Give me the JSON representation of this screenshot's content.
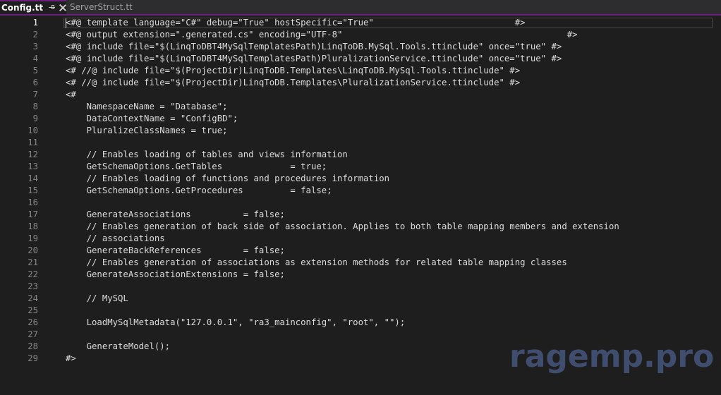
{
  "tabs": [
    {
      "label": "Config.tt"
    },
    {
      "label": "ServerStruct.tt"
    }
  ],
  "editor": {
    "lines": [
      {
        "n": "1",
        "text": "<#@ template language=\"C#\" debug=\"True\" hostSpecific=\"True\"                           #>"
      },
      {
        "n": "2",
        "text": "<#@ output extension=\".generated.cs\" encoding=\"UTF-8\"                                           #>"
      },
      {
        "n": "3",
        "text": "<#@ include file=\"$(LinqToDBT4MySqlTemplatesPath)LinqToDB.MySql.Tools.ttinclude\" once=\"true\" #>"
      },
      {
        "n": "4",
        "text": "<#@ include file=\"$(LinqToDBT4MySqlTemplatesPath)PluralizationService.ttinclude\" once=\"true\" #>"
      },
      {
        "n": "5",
        "text": "<# //@ include file=\"$(ProjectDir)LinqToDB.Templates\\LinqToDB.MySql.Tools.ttinclude\" #>"
      },
      {
        "n": "6",
        "text": "<# //@ include file=\"$(ProjectDir)LinqToDB.Templates\\PluralizationService.ttinclude\" #>"
      },
      {
        "n": "7",
        "text": "<#"
      },
      {
        "n": "8",
        "text": "    NamespaceName = \"Database\";"
      },
      {
        "n": "9",
        "text": "    DataContextName = \"ConfigBD\";"
      },
      {
        "n": "10",
        "text": "    PluralizeClassNames = true;"
      },
      {
        "n": "11",
        "text": ""
      },
      {
        "n": "12",
        "text": "    // Enables loading of tables and views information"
      },
      {
        "n": "13",
        "text": "    GetSchemaOptions.GetTables             = true;"
      },
      {
        "n": "14",
        "text": "    // Enables loading of functions and procedures information"
      },
      {
        "n": "15",
        "text": "    GetSchemaOptions.GetProcedures         = false;"
      },
      {
        "n": "16",
        "text": ""
      },
      {
        "n": "17",
        "text": "    GenerateAssociations          = false;"
      },
      {
        "n": "18",
        "text": "    // Enables generation of back side of association. Applies to both table mapping members and extension"
      },
      {
        "n": "19",
        "text": "    // associations"
      },
      {
        "n": "20",
        "text": "    GenerateBackReferences        = false;"
      },
      {
        "n": "21",
        "text": "    // Enables generation of associations as extension methods for related table mapping classes"
      },
      {
        "n": "22",
        "text": "    GenerateAssociationExtensions = false;"
      },
      {
        "n": "23",
        "text": ""
      },
      {
        "n": "24",
        "text": "    // MySQL"
      },
      {
        "n": "25",
        "text": ""
      },
      {
        "n": "26",
        "text": "    LoadMySqlMetadata(\"127.0.0.1\", \"ra3_mainconfig\", \"root\", \"\");"
      },
      {
        "n": "27",
        "text": ""
      },
      {
        "n": "28",
        "text": "    GenerateModel();"
      },
      {
        "n": "29",
        "text": "#>"
      }
    ]
  },
  "watermark": {
    "text": "ragemp.pro"
  },
  "colors": {
    "background": "#1e1e1e",
    "tab_accent": "#68217a",
    "line_number": "#858585",
    "code_text": "#dcdcdc"
  },
  "icons": {
    "pin": "pin-icon",
    "close": "close-icon"
  }
}
